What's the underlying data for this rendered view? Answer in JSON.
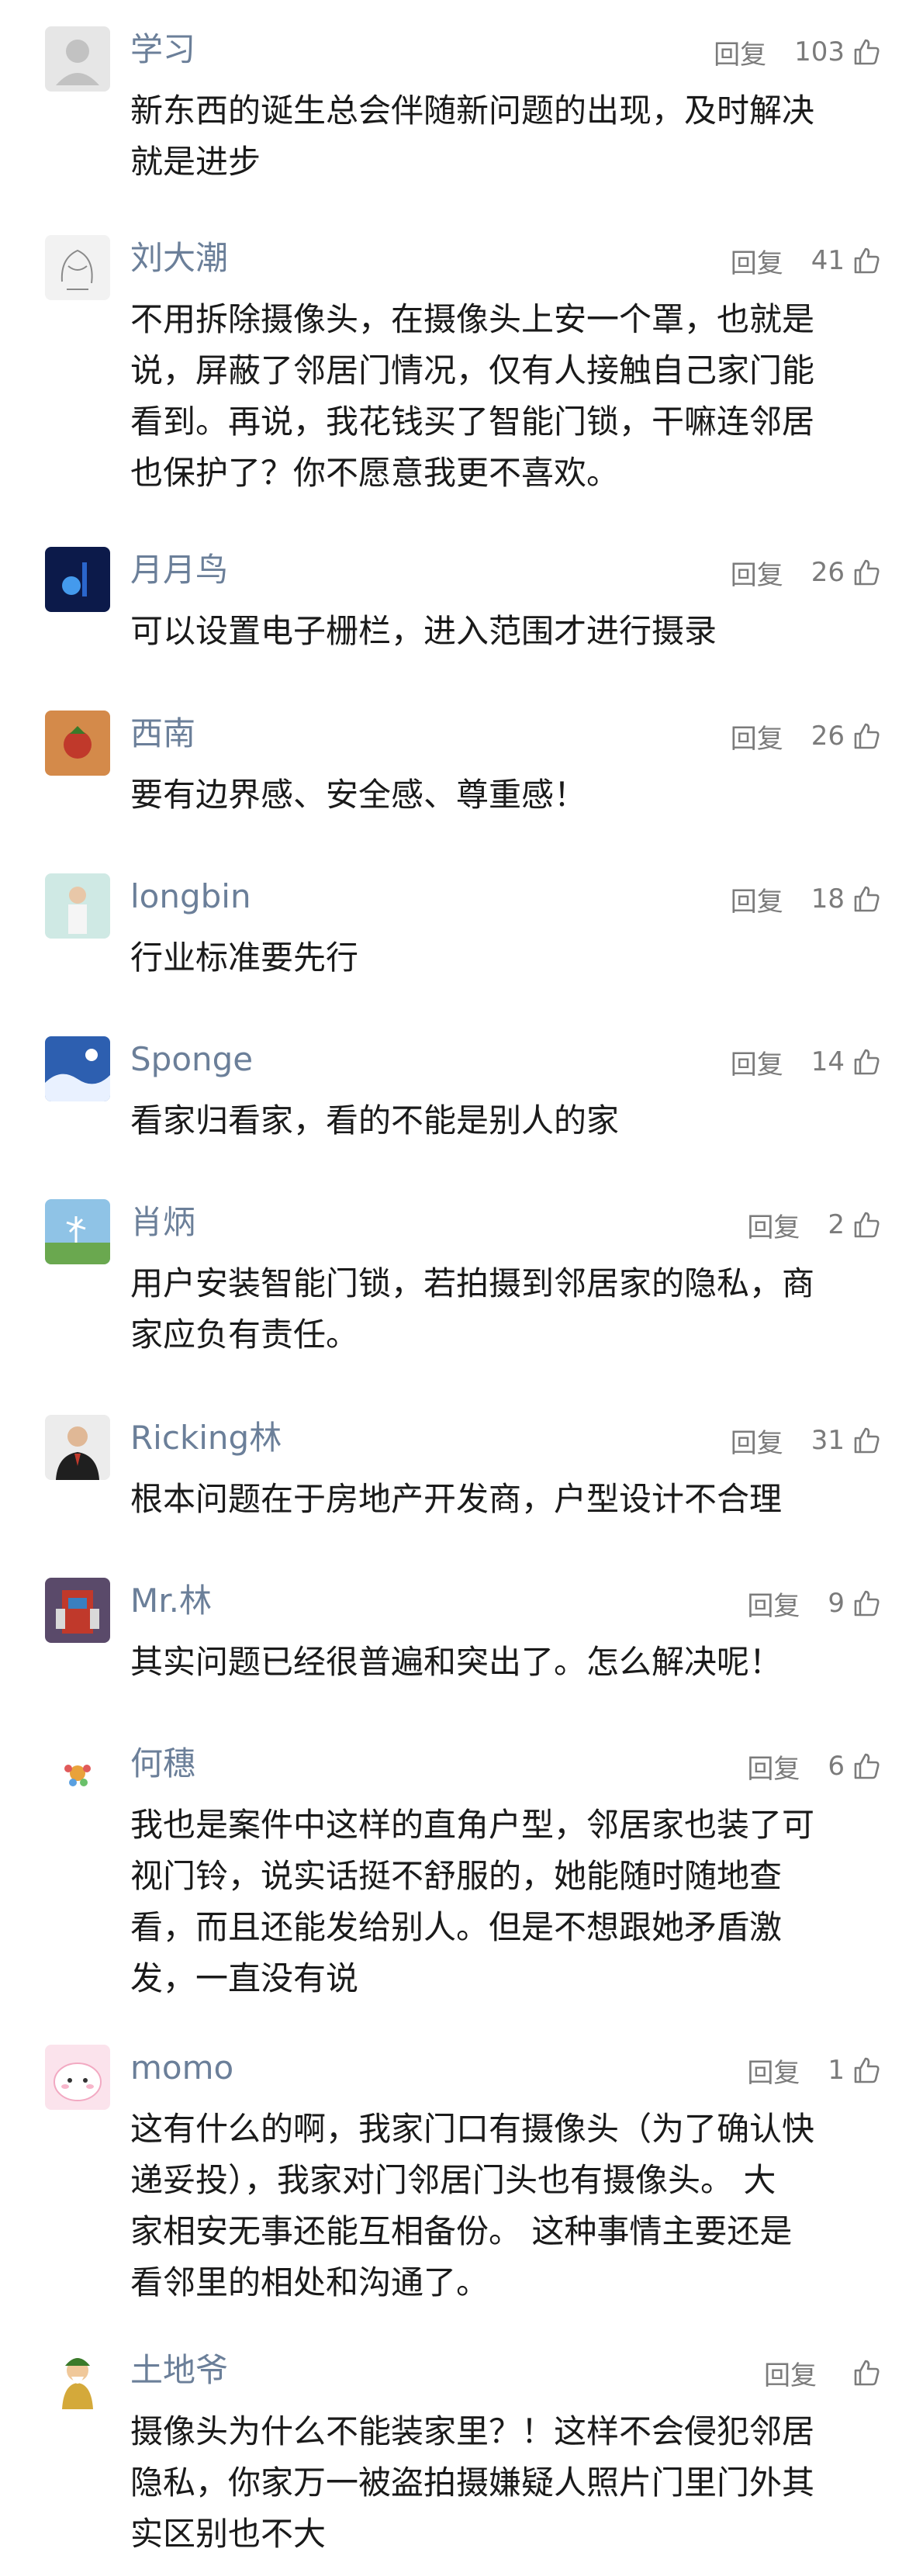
{
  "reply_label": "回复",
  "comments": [
    {
      "name": "学习",
      "likes": "103",
      "lines": [
        "新东西的诞生总会伴随新问题的出现，及时解决",
        "就是进步"
      ]
    },
    {
      "name": "刘大潮",
      "likes": "41",
      "lines": [
        "不用拆除摄像头，在摄像头上安一个罩，也就是",
        "说，屏蔽了邻居门情况，仅有人接触自己家门能",
        "看到。再说，我花钱买了智能门锁，干嘛连邻居",
        "也保护了？你不愿意我更不喜欢。"
      ]
    },
    {
      "name": "月月鸟",
      "likes": "26",
      "lines": [
        "可以设置电子栅栏，进入范围才进行摄录"
      ]
    },
    {
      "name": "西南",
      "likes": "26",
      "lines": [
        "要有边界感、安全感、尊重感！"
      ]
    },
    {
      "name": "longbin",
      "likes": "18",
      "lines": [
        "行业标准要先行"
      ]
    },
    {
      "name": "Sponge",
      "likes": "14",
      "lines": [
        "看家归看家，看的不能是别人的家"
      ]
    },
    {
      "name": "肖炳",
      "likes": "2",
      "lines": [
        "用户安装智能门锁，若拍摄到邻居家的隐私，商",
        "家应负有责任。"
      ]
    },
    {
      "name": "Ricking林",
      "likes": "31",
      "lines": [
        "根本问题在于房地产开发商，户型设计不合理"
      ]
    },
    {
      "name": "Mr.林",
      "likes": "9",
      "lines": [
        "其实问题已经很普遍和突出了。怎么解决呢！"
      ]
    },
    {
      "name": "何穗",
      "likes": "6",
      "lines": [
        "我也是案件中这样的直角户型，邻居家也装了可",
        "视门铃，说实话挺不舒服的，她能随时随地查",
        "看，而且还能发给别人。但是不想跟她矛盾激",
        "发，一直没有说"
      ]
    },
    {
      "name": "momo",
      "likes": "1",
      "lines": [
        "这有什么的啊，我家门口有摄像头（为了确认快",
        "递妥投），我家对门邻居门头也有摄像头。 大",
        "家相安无事还能互相备份。 这种事情主要还是",
        "看邻里的相处和沟通了。"
      ]
    },
    {
      "name": "土地爷",
      "likes": "",
      "lines": [
        "摄像头为什么不能装家里？！这样不会侵犯邻居",
        "隐私，你家万一被盗拍摄嫌疑人照片门里门外其",
        "实区别也不大"
      ]
    }
  ]
}
